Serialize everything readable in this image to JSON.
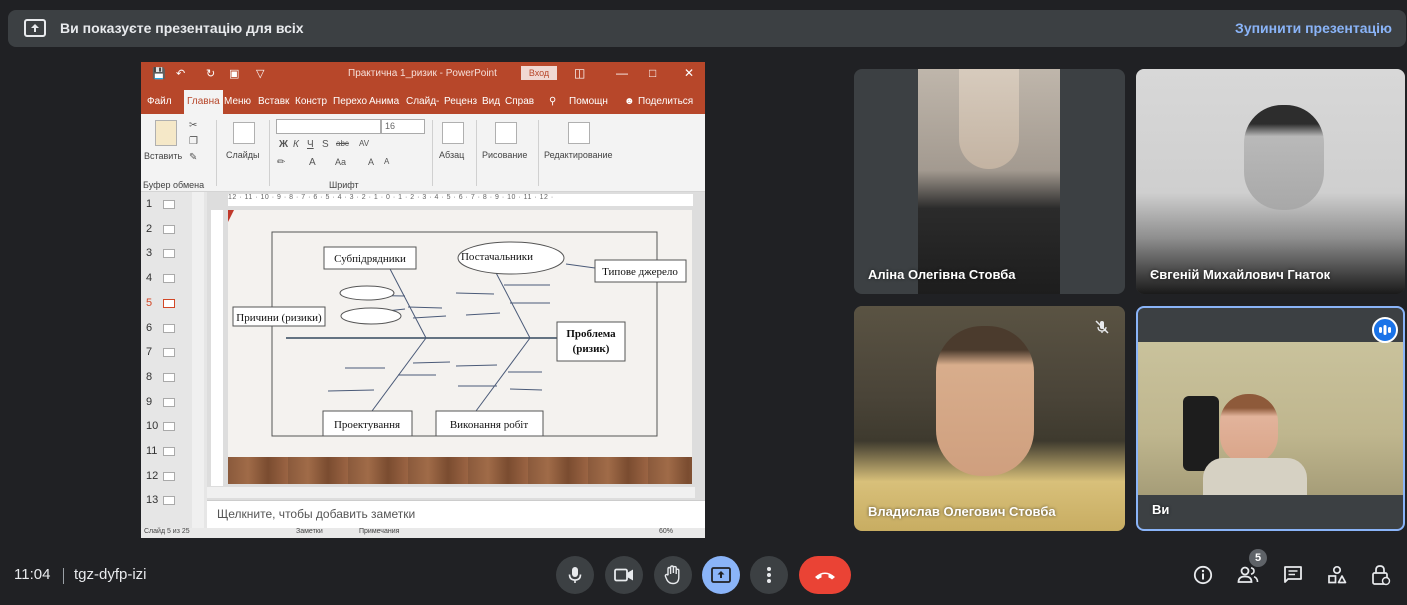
{
  "banner": {
    "message": "Ви показуєте презентацію для всіх",
    "stop_label": "Зупинити презентацію"
  },
  "powerpoint": {
    "window_title": "Практична 1_ризик - PowerPoint",
    "login_label": "Вход",
    "tabs": [
      "Файл",
      "Главна",
      "Меню",
      "Вставка",
      "Констр",
      "Перехо",
      "Анима",
      "Слайд-",
      "Реценз",
      "Вид",
      "Справ"
    ],
    "help_label": "Помощн",
    "share_label": "Поделиться",
    "ribbon": {
      "paste_label": "Вставить",
      "slides_label": "Слайды",
      "paragraph_label": "Абзац",
      "drawing_label": "Рисование",
      "editing_label": "Редактирование",
      "clipboard_label": "Буфер обмена",
      "font_group_label": "Шрифт",
      "font_size": "16"
    },
    "slide_numbers": [
      "1",
      "2",
      "3",
      "4",
      "5",
      "6",
      "7",
      "8",
      "9",
      "10",
      "11",
      "12",
      "13"
    ],
    "active_slide_index": 4,
    "ruler_text": "12 · 11 · 10 · 9 · 8 · 7 · 6 · 5 · 4 · 3 · 2 · 1 · 0 · 1 · 2 · 3 · 4 · 5 · 6 · 7 · 8 · 9 · 10 · 11 · 12 ·",
    "notes_placeholder": "Щелкните, чтобы добавить заметки",
    "status": {
      "slide_info": "Слайд 5 из 25",
      "notes_label": "Заметки",
      "comments_label": "Примечания",
      "zoom": "60%"
    }
  },
  "diagram": {
    "subcontractors": "Субпідрядники",
    "suppliers": "Постачальники",
    "typical_source": "Типове джерело",
    "causes": "Причини (ризики)",
    "problem_line1": "Проблема",
    "problem_line2": "(ризик)",
    "design": "Проектування",
    "works": "Виконання робіт"
  },
  "participants": [
    {
      "name": "Аліна Олегівна Стовба",
      "muted": false
    },
    {
      "name": "Євгеній Михайлович Гнаток",
      "muted": false
    },
    {
      "name": "Владислав Олегович Стовба",
      "muted": true
    },
    {
      "name": "Ви",
      "speaking": true
    }
  ],
  "bottom": {
    "time": "11:04",
    "meeting_code": "tgz-dyfp-izi",
    "participants_count": "5"
  },
  "colors": {
    "background": "#202124",
    "accent": "#8ab4f8",
    "end_call": "#ea4335",
    "ppt_brand": "#b7472a"
  },
  "icons": {
    "presenting": "present-to-all-icon",
    "mic": "microphone-icon",
    "camera": "camera-icon",
    "hand": "raise-hand-icon",
    "present": "present-screen-icon",
    "more": "more-vert-icon",
    "end": "call-end-icon",
    "info": "info-icon",
    "people": "people-icon",
    "chat": "chat-icon",
    "activities": "activities-icon",
    "lock": "host-controls-icon"
  }
}
